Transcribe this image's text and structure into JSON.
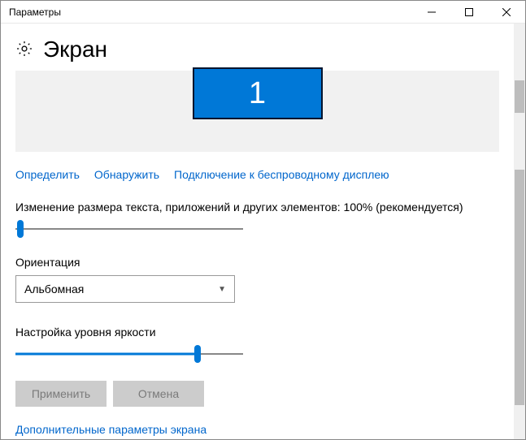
{
  "window": {
    "title": "Параметры"
  },
  "page": {
    "heading": "Экран",
    "monitor_number": "1",
    "links": {
      "identify": "Определить",
      "detect": "Обнаружить",
      "wireless": "Подключение к беспроводному дисплею"
    },
    "scale": {
      "label": "Изменение размера текста, приложений и других элементов: 100% (рекомендуется)",
      "percent": 0
    },
    "orientation": {
      "label": "Ориентация",
      "value": "Альбомная"
    },
    "brightness": {
      "label": "Настройка уровня яркости",
      "percent": 80
    },
    "buttons": {
      "apply": "Применить",
      "cancel": "Отмена"
    },
    "additional": "Дополнительные параметры экрана"
  }
}
